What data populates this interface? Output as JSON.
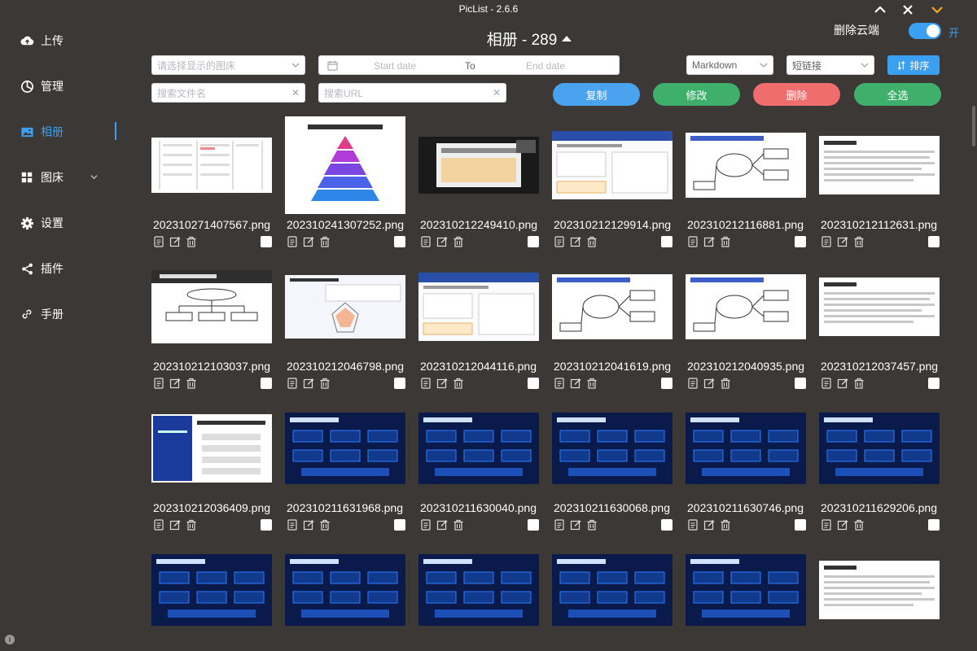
{
  "window": {
    "title": "PicList - 2.6.6"
  },
  "sidebar": {
    "items": [
      {
        "label": "上传",
        "icon": "upload-cloud-icon"
      },
      {
        "label": "管理",
        "icon": "pie-chart-icon"
      },
      {
        "label": "相册",
        "icon": "image-icon",
        "active": true
      },
      {
        "label": "图床",
        "icon": "grid-icon"
      },
      {
        "label": "设置",
        "icon": "gear-icon"
      },
      {
        "label": "插件",
        "icon": "share-icon"
      },
      {
        "label": "手册",
        "icon": "link-icon"
      }
    ]
  },
  "header": {
    "title": "相册 - 289",
    "cloud_delete_label": "删除云端",
    "toggle_label": "开"
  },
  "filters": {
    "bed_placeholder": "请选择显示的图床",
    "date_start": "Start date",
    "date_to": "To",
    "date_end": "End date",
    "format_value": "Markdown",
    "link_value": "短链接",
    "sort_label": "排序",
    "filename_placeholder": "搜索文件名",
    "url_placeholder": "搜索URL"
  },
  "actions": {
    "copy": "复制",
    "edit": "修改",
    "delete": "删除",
    "select_all": "全选"
  },
  "colors": {
    "accent": "#3b9ff2",
    "copy": "#4aa3ee",
    "edit": "#3faf6c",
    "delete": "#f06d6d",
    "select_all": "#3faf6c",
    "background": "#3b3836"
  },
  "images": [
    {
      "name": "202310271407567.png",
      "style": "doc"
    },
    {
      "name": "202310241307252.png",
      "style": "pyramid"
    },
    {
      "name": "202310212249410.png",
      "style": "video"
    },
    {
      "name": "202310212129914.png",
      "style": "slide-light"
    },
    {
      "name": "202310212116881.png",
      "style": "diagram-light"
    },
    {
      "name": "202310212112631.png",
      "style": "text-light"
    },
    {
      "name": "202310212103037.png",
      "style": "tree"
    },
    {
      "name": "202310212046798.png",
      "style": "radar"
    },
    {
      "name": "202310212044116.png",
      "style": "slide-light"
    },
    {
      "name": "202310212041619.png",
      "style": "diagram-light"
    },
    {
      "name": "202310212040935.png",
      "style": "diagram-light"
    },
    {
      "name": "202310212037457.png",
      "style": "text-light"
    },
    {
      "name": "202310212036409.png",
      "style": "book"
    },
    {
      "name": "202310211631968.png",
      "style": "dark"
    },
    {
      "name": "202310211630040.png",
      "style": "dark"
    },
    {
      "name": "202310211630068.png",
      "style": "dark"
    },
    {
      "name": "202310211630746.png",
      "style": "dark"
    },
    {
      "name": "202310211629206.png",
      "style": "dark"
    },
    {
      "name": "",
      "style": "dark"
    },
    {
      "name": "",
      "style": "dark"
    },
    {
      "name": "",
      "style": "dark"
    },
    {
      "name": "",
      "style": "dark"
    },
    {
      "name": "",
      "style": "dark"
    },
    {
      "name": "",
      "style": "text-light"
    }
  ]
}
